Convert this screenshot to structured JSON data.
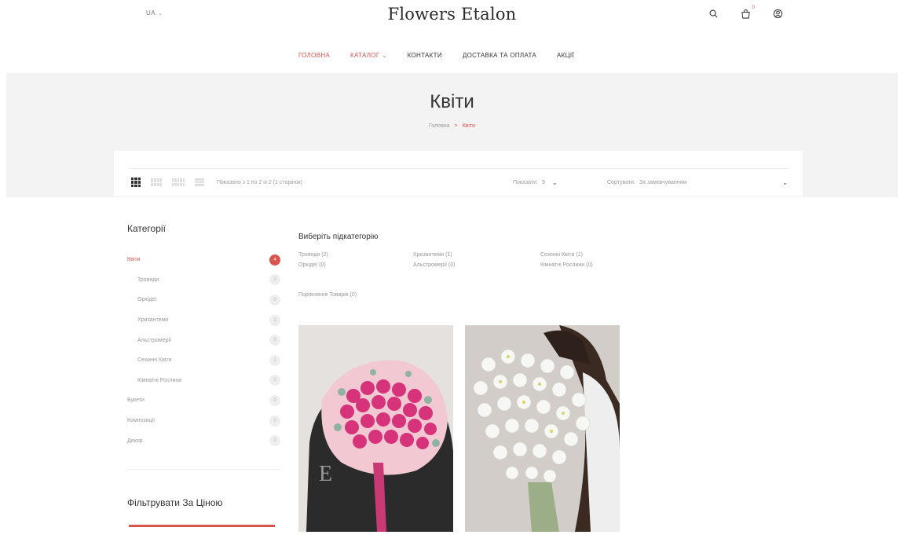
{
  "header": {
    "lang": "UA",
    "logo": "Flowers Etalon",
    "cart_count": "0",
    "nav": [
      {
        "label": "ГОЛОВНА",
        "active": true
      },
      {
        "label": "КАТАЛОГ",
        "dropdown": true
      },
      {
        "label": "КОНТАКТИ"
      },
      {
        "label": "ДОСТАВКА ТА ОПЛАТА"
      },
      {
        "label": "АКЦІЇ"
      }
    ]
  },
  "page": {
    "title": "Квіти",
    "breadcrumb": {
      "home": "Головна",
      "separator": ">",
      "current": "Квіти"
    }
  },
  "toolbar": {
    "results": "Показано з 1 по 2 із 2 (1 сторінок)",
    "show_label": "Показати:",
    "show_value": "9",
    "sort_label": "Сортувати:",
    "sort_value": "За замовчуванням"
  },
  "sidebar": {
    "categories_title": "Категорії",
    "categories": [
      {
        "label": "Квіти",
        "count": "4",
        "active": true,
        "sub": false
      },
      {
        "label": "Троянди",
        "count": "2",
        "sub": true
      },
      {
        "label": "Орхідеї",
        "count": "0",
        "sub": true
      },
      {
        "label": "Хризантеми",
        "count": "1",
        "sub": true
      },
      {
        "label": "Альстромерії",
        "count": "0",
        "sub": true
      },
      {
        "label": "Сезонні Квіти",
        "count": "1",
        "sub": true
      },
      {
        "label": "Кімнатні Рослини",
        "count": "0",
        "sub": true
      },
      {
        "label": "Букети",
        "count": "0",
        "sub": false
      },
      {
        "label": "Композиції",
        "count": "0",
        "sub": false
      },
      {
        "label": "Декор",
        "count": "0",
        "sub": false
      }
    ],
    "filter_title": "Фільтрувати За Ціною"
  },
  "main": {
    "subcategory_title": "Виберіть підкатегорію",
    "subcategories": [
      "Троянди (2)",
      "Хризантеми (1)",
      "Сезонні Квіти (1)",
      "Орхідеї (0)",
      "Альстромерії (0)",
      "Кімнатні Рослини (0)"
    ],
    "extra_subcategory": "Порівняння Товарів (0)"
  },
  "colors": {
    "accent": "#d9534f",
    "band": "#f3f3f3",
    "text": "#333333",
    "muted": "#999999"
  }
}
